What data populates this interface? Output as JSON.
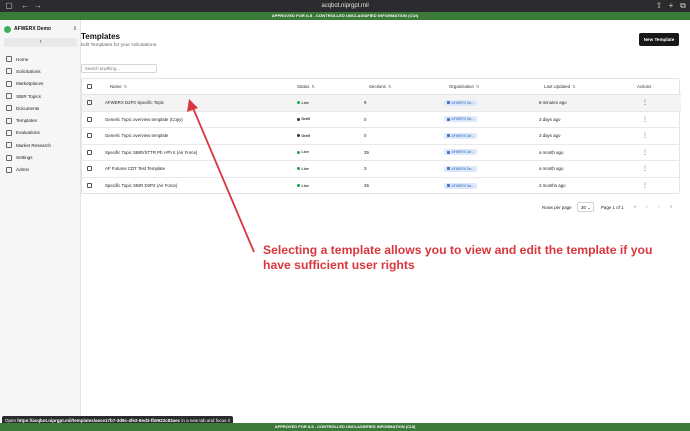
{
  "browser": {
    "url": "acqbot.niprgpt.mil",
    "banner_top": "APPROVED FOR IL5 - CONTROLLED UNCLASSIFIED INFORMATION (CUI)",
    "banner_bottom": "APPROVED FOR IL5 - CONTROLLED UNCLASSIFIED INFORMATION (CUI)",
    "status_prefix": "Open",
    "status_link": "https://acqbot.niprgpt.mil/templates/aece17b7-3d9c-4fe2-8ed3-fb5922c83aec",
    "status_suffix": "in a new tab and focus it"
  },
  "sidebar": {
    "org_name": "AFWERX Demo",
    "collapse_label": "‹",
    "items": [
      {
        "label": "Home",
        "icon": "home-icon"
      },
      {
        "label": "Solicitations",
        "icon": "document-icon"
      },
      {
        "label": "Marketplaces",
        "icon": "store-icon"
      },
      {
        "label": "SBIR Topics",
        "icon": "list-icon"
      },
      {
        "label": "Documents",
        "icon": "file-icon"
      },
      {
        "label": "Templates",
        "icon": "template-icon"
      },
      {
        "label": "Evaluations",
        "icon": "check-icon"
      },
      {
        "label": "Market Research",
        "icon": "search-icon"
      },
      {
        "label": "Settings",
        "icon": "gear-icon"
      },
      {
        "label": "Admin",
        "icon": "user-icon"
      }
    ]
  },
  "main": {
    "title": "Templates",
    "subtitle": "Edit Templates for your solicitations.",
    "new_button": "New Template",
    "search_placeholder": "Search anything...",
    "columns": {
      "name": "Name",
      "status": "Status",
      "sections": "Sections",
      "organization": "Organization",
      "last_updated": "Last Updated",
      "actions": "Actions"
    },
    "rows": [
      {
        "name": "AFWERX D2P2 Specific Topic",
        "status": "Live",
        "status_color": "#22a447",
        "sections": "9",
        "org": "AFWERX De...",
        "updated": "8 minutes ago"
      },
      {
        "name": "Generic Topic overview template (Copy)",
        "status": "Draft",
        "status_color": "#333333",
        "sections": "0",
        "org": "AFWERX De...",
        "updated": "3 days ago"
      },
      {
        "name": "Generic Topic overview template",
        "status": "Draft",
        "status_color": "#333333",
        "sections": "0",
        "org": "AFWERX De...",
        "updated": "3 days ago"
      },
      {
        "name": "Specific Topic SBIR/STTR Ph I-Ph II (Air Force)",
        "status": "Live",
        "status_color": "#22a447",
        "sections": "35",
        "org": "AFWERX De...",
        "updated": "a month ago"
      },
      {
        "name": "AF Futures CDT Test Template",
        "status": "Live",
        "status_color": "#22a447",
        "sections": "3",
        "org": "AFWERX De...",
        "updated": "a month ago"
      },
      {
        "name": "Specific Topic SBIR D2P2 (Air Force)",
        "status": "Live",
        "status_color": "#22a447",
        "sections": "36",
        "org": "AFWERX De...",
        "updated": "2 months ago"
      }
    ],
    "pagination": {
      "rows_per_page_label": "Rows per page",
      "rows_per_page_value": "30",
      "page_label": "Page 1 of 1"
    }
  },
  "annotation": {
    "text": "Selecting a template allows you to view and edit the template if you have sufficient user rights",
    "color": "#d9363e"
  }
}
